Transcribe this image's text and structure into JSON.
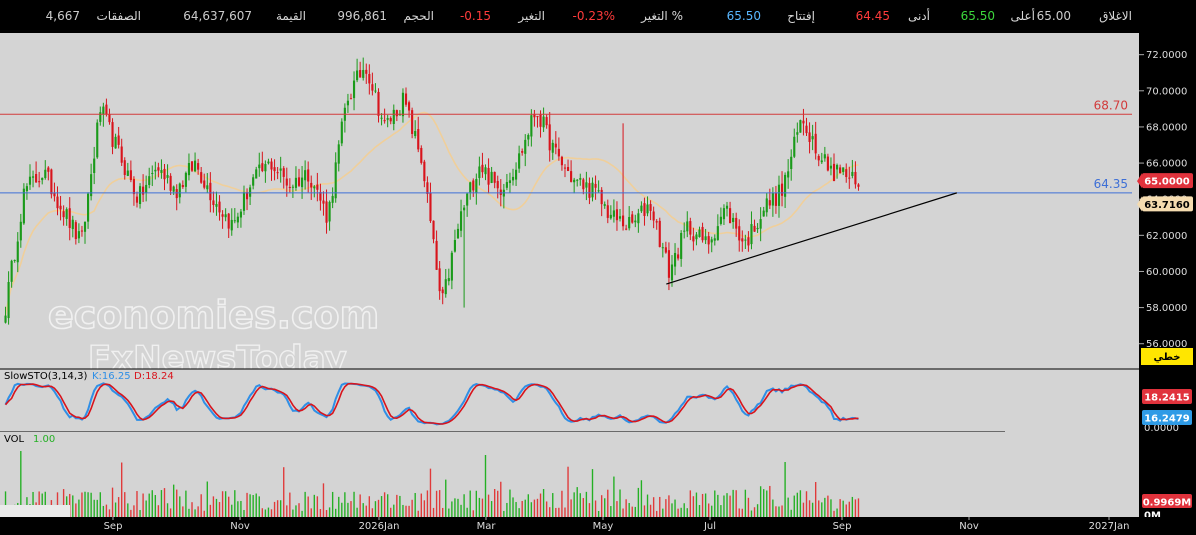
{
  "header": {
    "items": [
      {
        "label": "الاغلاق",
        "value": "65.00",
        "color": "#cccccc"
      },
      {
        "label": "أعلى",
        "value": "65.50",
        "color": "#3cd63c"
      },
      {
        "label": "أدنى",
        "value": "64.45",
        "color": "#ff3b3b"
      },
      {
        "label": "إفتتاح",
        "value": "65.50",
        "color": "#59b7ff"
      },
      {
        "label": "التغير %",
        "value": "-0.23%",
        "color": "#ff3b3b"
      },
      {
        "label": "التغير",
        "value": "-0.15",
        "color": "#ff3b3b"
      },
      {
        "label": "الحجم",
        "value": "996,861",
        "color": "#cccccc"
      },
      {
        "label": "القيمة",
        "value": "64,637,607",
        "color": "#cccccc"
      },
      {
        "label": "الصفقات",
        "value": "4,667",
        "color": "#cccccc"
      }
    ]
  },
  "watermark": {
    "line1": "economies.com",
    "line2": "FxNewsToday"
  },
  "chart_data": [
    {
      "type": "candlestick",
      "name": "price",
      "ylim": [
        54.6,
        73.2
      ],
      "yticks": [
        "72.0000",
        "70.0000",
        "68.0000",
        "66.0000",
        "64.0000",
        "62.0000",
        "60.0000",
        "58.0000",
        "56.0000"
      ],
      "xticks": [
        "Sep",
        "Nov",
        "2026Jan",
        "Mar",
        "May",
        "Jul",
        "Sep",
        "Nov",
        "2027Jan"
      ],
      "horizontal_lines": [
        {
          "value": 68.7,
          "label": "68.70",
          "color": "#d23b3b"
        },
        {
          "value": 64.35,
          "label": "64.35",
          "color": "#3d6fd6"
        }
      ],
      "trendline": {
        "from": [
          0.585,
          59.3
        ],
        "to": [
          0.8,
          64.35
        ]
      },
      "price_tags": [
        {
          "value": "65.0000",
          "bg": "#e0323c",
          "fg": "#ffffff"
        },
        {
          "value": "63.7160",
          "bg": "#f5dcb0",
          "fg": "#000000"
        }
      ],
      "button_label": "خطي",
      "up_color": "#1a9a1a",
      "down_color": "#d8141c",
      "ma_color": "#f0cf9a",
      "series": [
        {
          "name": "key",
          "values": [
            58.0,
            64.5,
            65.5,
            63.5,
            61.5,
            69.0,
            66.5,
            64.0,
            65.8,
            64.5,
            66.0,
            64.0,
            62.5,
            65.0,
            66.0,
            64.8,
            65.5,
            63.0,
            69.5,
            71.5,
            68.0,
            69.5,
            66.0,
            58.0,
            63.0,
            66.0,
            64.5,
            66.0,
            69.0,
            66.5,
            65.0,
            64.5,
            63.0,
            62.5,
            63.8,
            60.0,
            62.5,
            61.5,
            63.5,
            61.5,
            63.5,
            64.5,
            68.5,
            66.5,
            65.5,
            65.0
          ]
        }
      ]
    },
    {
      "type": "line",
      "name": "stochastic",
      "title": "SlowSTO(3,14,3)",
      "k_label": "K:16.25",
      "d_label": "D:18.24",
      "k_color": "#2f8fe6",
      "d_color": "#d8141c",
      "tags": [
        {
          "value": "18.2415",
          "bg": "#e0323c",
          "fg": "#ffffff"
        },
        {
          "value": "16.2479",
          "bg": "#2f9be6",
          "fg": "#ffffff"
        }
      ],
      "tag_hidden_text": "0.0000"
    },
    {
      "type": "bar",
      "name": "volume",
      "title": "VOL",
      "vol_label": "1.00",
      "bar_color": "#e03a3a",
      "bar_color_up": "#24b024",
      "tags": [
        {
          "value": "0.9969M",
          "bg": "#e0323c",
          "fg": "#ffffff"
        },
        {
          "value": "0M",
          "bg": "none",
          "fg": "#ffffff"
        }
      ]
    }
  ]
}
